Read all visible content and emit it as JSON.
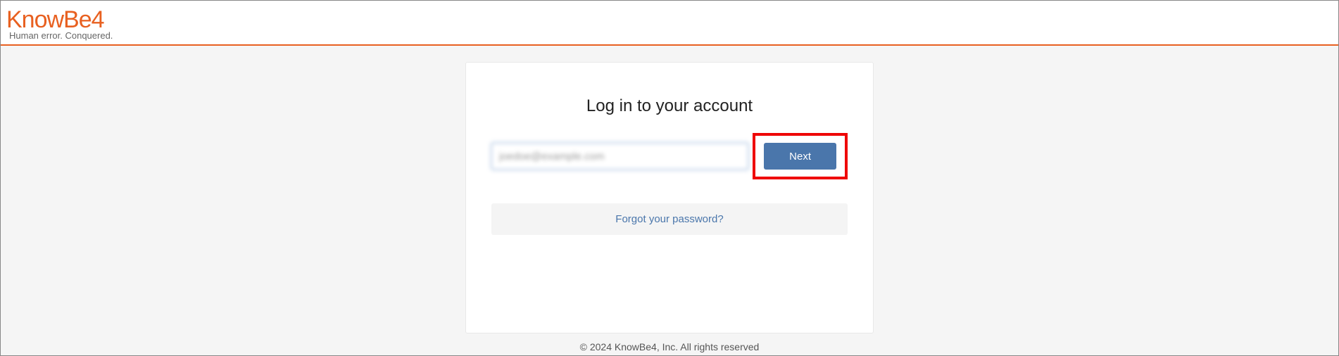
{
  "header": {
    "logo_text": "KnowBe4",
    "tagline": "Human error. Conquered."
  },
  "login": {
    "title": "Log in to your account",
    "email_value": "joedoe@example.com",
    "next_label": "Next",
    "forgot_label": "Forgot your password?"
  },
  "footer": {
    "copyright": "© 2024 KnowBe4, Inc. All rights reserved"
  }
}
